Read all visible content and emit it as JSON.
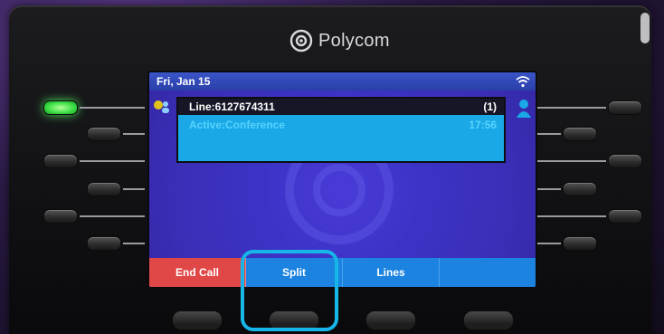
{
  "device": {
    "brand": "Polycom",
    "icons": {
      "logo": "polycom-logo-icon",
      "wifi": "wifi-icon",
      "conference": "conference-icon",
      "user": "user-icon"
    }
  },
  "screen": {
    "date": "Fri, Jan 15",
    "call": {
      "line": "Line:6127674311",
      "count": "(1)",
      "status": "Active:Conference",
      "duration": "17:56"
    },
    "softkeys": [
      "End Call",
      "Split",
      "Lines",
      ""
    ]
  },
  "colors": {
    "status_bar": "#2a3fa8",
    "screen_bg": "#3c33c6",
    "call_highlight": "#1aa9e6",
    "end_call": "#e04848",
    "softkey_bar": "#1c83e0",
    "active_led": "#3de047",
    "highlight_ring": "#16b6e8"
  }
}
